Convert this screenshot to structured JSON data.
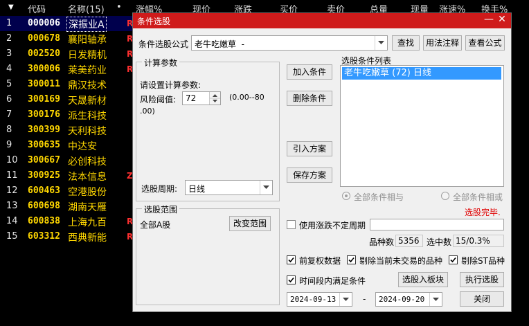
{
  "grid": {
    "headers": {
      "sort_icon": "sort-down-triangle",
      "code": "代码",
      "name": "名称(15)",
      "dot": "•",
      "change_pct": "涨幅%",
      "price": "现价",
      "change": "涨跌",
      "bid": "买价",
      "ask": "卖价",
      "volume": "总量",
      "cur_vol": "现量",
      "speed": "涨速%",
      "turnover": "换手%"
    },
    "rows": [
      {
        "idx": "1",
        "code": "000006",
        "name": "深振业A",
        "flag": "R"
      },
      {
        "idx": "2",
        "code": "000678",
        "name": "襄阳轴承",
        "flag": "R"
      },
      {
        "idx": "3",
        "code": "002520",
        "name": "日发精机",
        "flag": "R"
      },
      {
        "idx": "4",
        "code": "300006",
        "name": "莱美药业",
        "flag": "R"
      },
      {
        "idx": "5",
        "code": "300011",
        "name": "鼎汉技术",
        "flag": ""
      },
      {
        "idx": "6",
        "code": "300169",
        "name": "天晟新材",
        "flag": ""
      },
      {
        "idx": "7",
        "code": "300176",
        "name": "派生科技",
        "flag": ""
      },
      {
        "idx": "8",
        "code": "300399",
        "name": "天利科技",
        "flag": ""
      },
      {
        "idx": "9",
        "code": "300635",
        "name": "中达安",
        "flag": ""
      },
      {
        "idx": "10",
        "code": "300667",
        "name": "必创科技",
        "flag": ""
      },
      {
        "idx": "11",
        "code": "300925",
        "name": "法本信息",
        "flag": "Z"
      },
      {
        "idx": "12",
        "code": "600463",
        "name": "空港股份",
        "flag": ""
      },
      {
        "idx": "13",
        "code": "600698",
        "name": "湖南天雁",
        "flag": ""
      },
      {
        "idx": "14",
        "code": "600838",
        "name": "上海九百",
        "flag": "R"
      },
      {
        "idx": "15",
        "code": "603312",
        "name": "西典新能",
        "flag": "R"
      }
    ]
  },
  "dialog": {
    "title": "条件选股",
    "minimize": "—",
    "close": "✕",
    "formula_label": "条件选股公式",
    "formula_value": "老牛吃嫩草  -",
    "find_button": "查找",
    "usage_button": "用法注释",
    "view_formula_button": "查看公式",
    "params_group": "计算参数",
    "params_prompt": "请设置计算参数:",
    "risk_label": "风险阈值:",
    "risk_value": "72",
    "risk_range_1": "(0.00--80",
    "risk_range_2": ".00)",
    "period_label": "选股周期:",
    "period_value": "日线",
    "add_condition": "加入条件",
    "delete_condition": "删除条件",
    "import_scheme": "引入方案",
    "save_scheme": "保存方案",
    "cond_list_label": "选股条件列表",
    "cond_list": [
      "老牛吃嫩草 (72) 日线"
    ],
    "radio_and": "全部条件相与",
    "radio_or": "全部条件相或",
    "status": "选股完毕.",
    "status_color": "#e00000",
    "scope_group": "选股范围",
    "scope_value": "全部A股",
    "change_scope": "改变范围",
    "use_period_label": "使用涨跌不定周期",
    "varieties_label": "品种数",
    "varieties_value": "5356",
    "selected_label": "选中数",
    "selected_value": "15/0.3%",
    "prev_restore": "前复权数据",
    "exclude_untraded": "剔除当前未交易的品种",
    "exclude_st": "剔除ST品种",
    "period_satisfy": "时间段内满足条件",
    "select_into_board": "选股入板块",
    "execute": "执行选股",
    "start_date": "2024-09-13",
    "date_sep": "-",
    "end_date": "2024-09-20",
    "close_button": "关闭"
  }
}
